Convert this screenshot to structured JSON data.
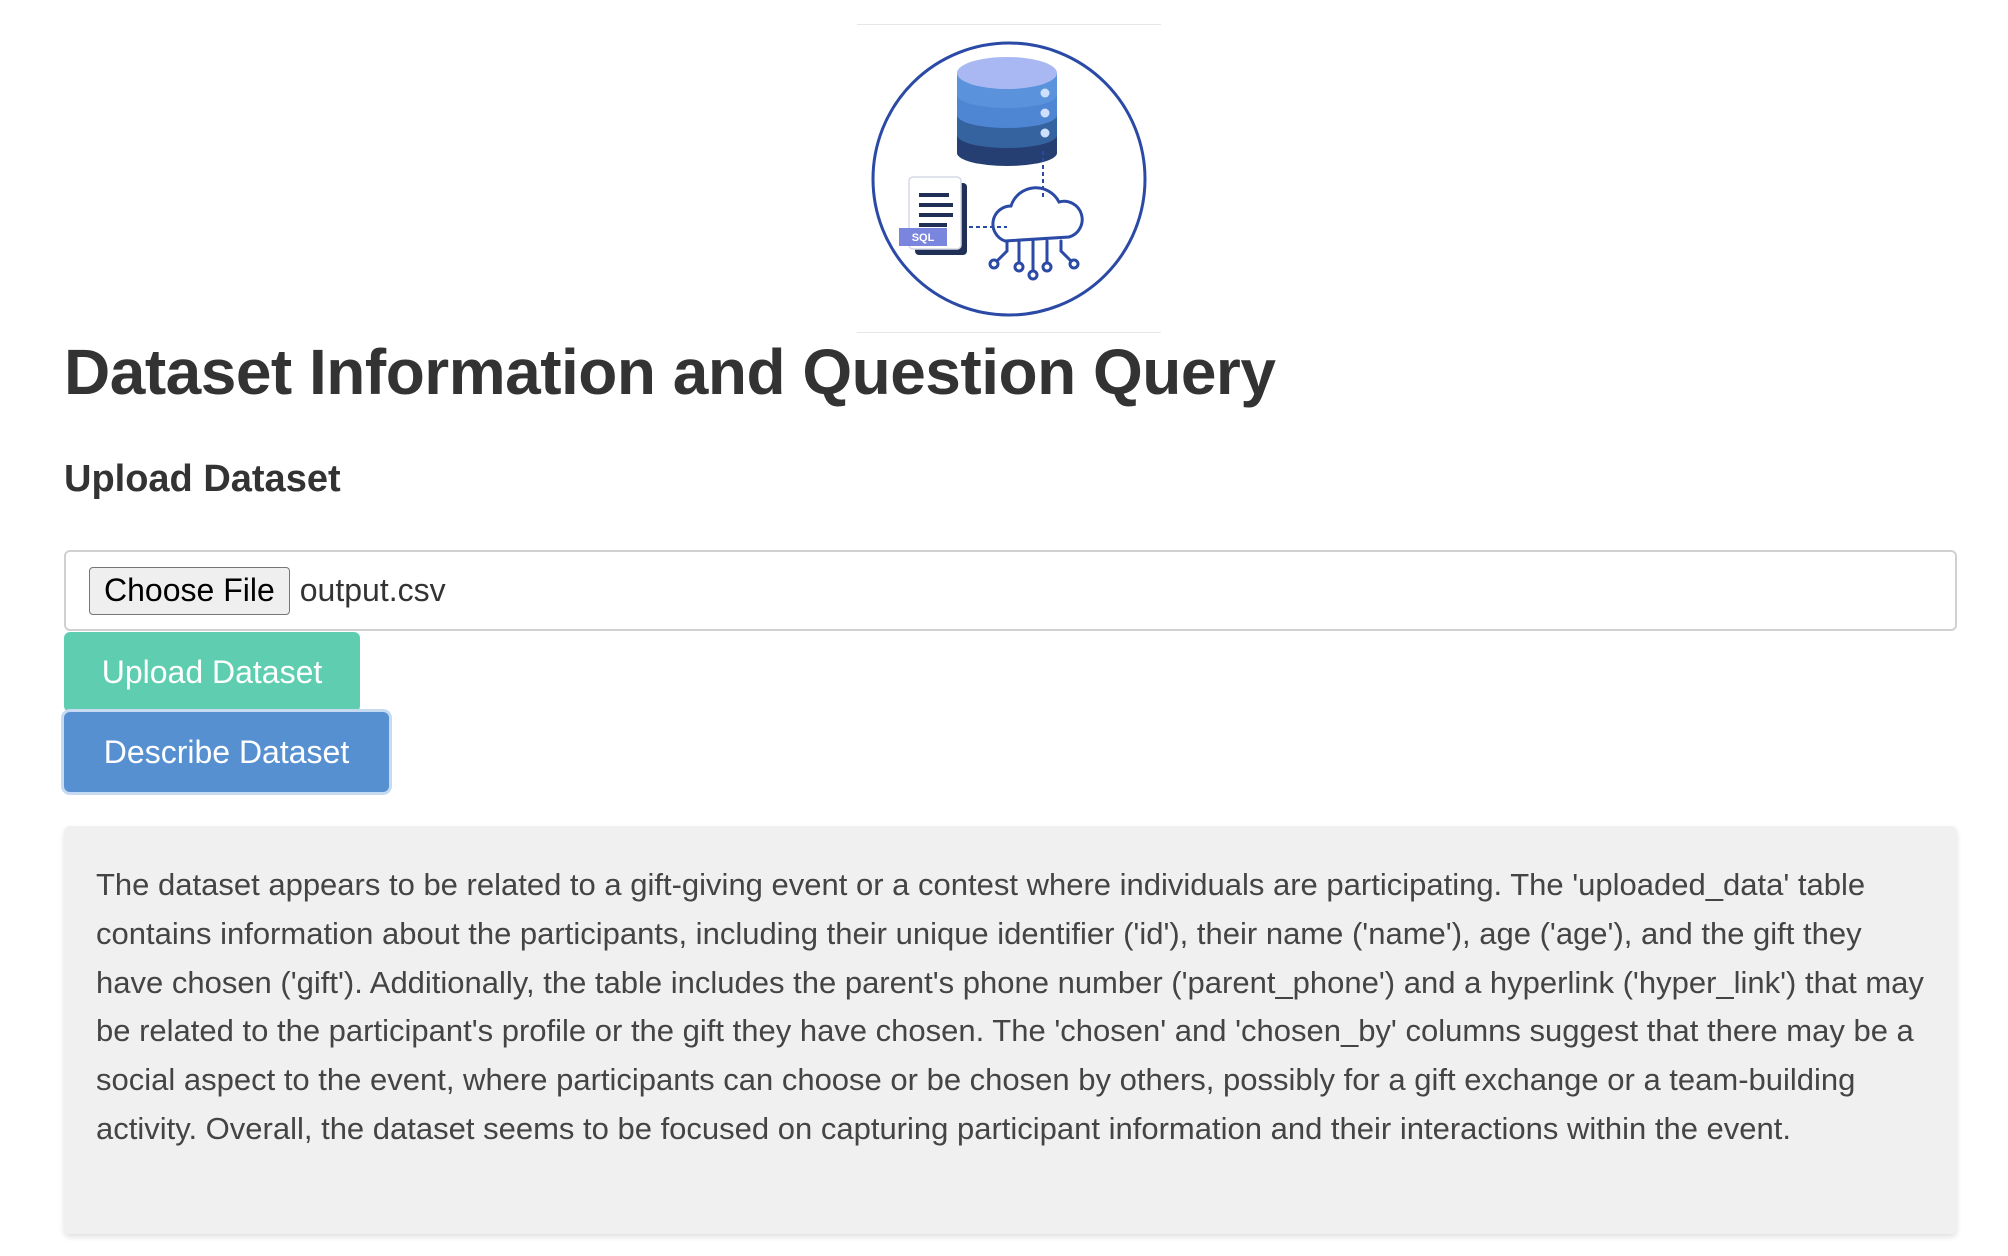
{
  "logo": {
    "badge_text": "SQL",
    "colors": {
      "ring": "#2a4aa6",
      "db_top": "#a9b8f2",
      "db_layer1": "#4f86d4",
      "db_layer2": "#35639f",
      "db_layer3": "#253f73",
      "badge": "#7a85dd"
    }
  },
  "header": {
    "title": "Dataset Information and Question Query"
  },
  "upload": {
    "section_title": "Upload Dataset",
    "choose_file_label": "Choose File",
    "selected_file": "output.csv",
    "upload_button_label": "Upload Dataset",
    "describe_button_label": "Describe Dataset"
  },
  "description": {
    "text": "The dataset appears to be related to a gift-giving event or a contest where individuals are participating. The 'uploaded_data' table contains information about the participants, including their unique identifier ('id'), their name ('name'), age ('age'), and the gift they have chosen ('gift'). Additionally, the table includes the parent's phone number ('parent_phone') and a hyperlink ('hyper_link') that may be related to the participant's profile or the gift they have chosen. The 'chosen' and 'chosen_by' columns suggest that there may be a social aspect to the event, where participants can choose or be chosen by others, possibly for a gift exchange or a team-building activity. Overall, the dataset seems to be focused on capturing participant information and their interactions within the event."
  },
  "colors": {
    "upload_button": "#5fceb0",
    "describe_button": "#5690d1",
    "description_background": "#f0f0f0",
    "text": "#333333"
  }
}
